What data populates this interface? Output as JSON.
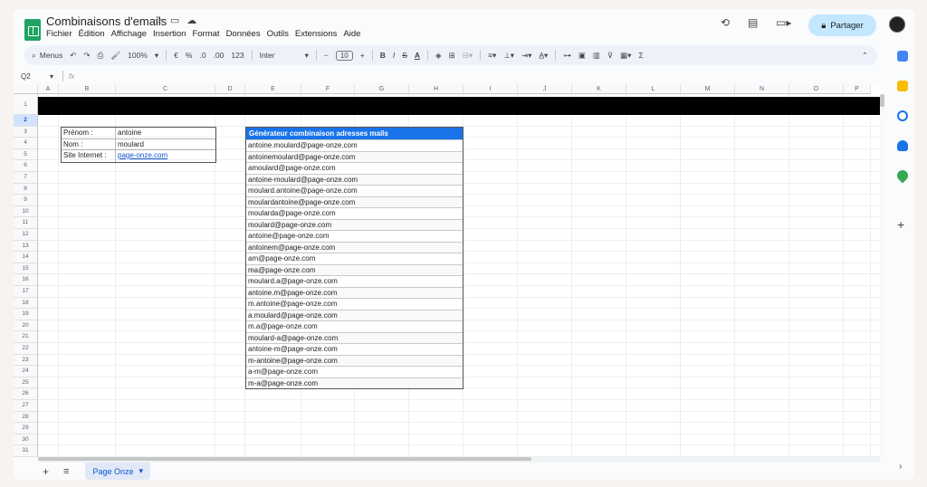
{
  "doc": {
    "title": "Combinaisons d'emails",
    "menu": [
      "Fichier",
      "Édition",
      "Affichage",
      "Insertion",
      "Format",
      "Données",
      "Outils",
      "Extensions",
      "Aide"
    ]
  },
  "share": {
    "label": "Partager"
  },
  "toolbar": {
    "search_label": "Menus",
    "zoom": "100%",
    "currency": "€",
    "percent": "%",
    "dec_less": ".0",
    "dec_more": ".00",
    "number_format": "123",
    "font": "Inter",
    "font_size": "10",
    "minus": "−",
    "plus": "+",
    "bold": "B",
    "italic": "I",
    "strike": "S",
    "sigma": "Σ"
  },
  "formula_bar": {
    "cell_ref": "Q2",
    "fx": "fx"
  },
  "columns": [
    "A",
    "B",
    "C",
    "D",
    "E",
    "F",
    "G",
    "H",
    "I",
    "J",
    "K",
    "L",
    "M",
    "N",
    "O",
    "P"
  ],
  "rows": [
    "1",
    "2",
    "3",
    "4",
    "5",
    "6",
    "7",
    "8",
    "9",
    "10",
    "11",
    "12",
    "13",
    "14",
    "15",
    "16",
    "17",
    "18",
    "19",
    "20",
    "21",
    "22",
    "23",
    "24",
    "25",
    "26",
    "27",
    "28",
    "29",
    "30",
    "31"
  ],
  "info_table": {
    "rows": [
      {
        "label": "Prénom :",
        "value": "antoine"
      },
      {
        "label": "Nom :",
        "value": "moulard"
      },
      {
        "label": "Site Internet :",
        "value": "page-onze.com"
      }
    ]
  },
  "generator": {
    "header": "Générateur combinaison adresses mails",
    "emails": [
      "antoine.moulard@page-onze.com",
      "antoinemoulard@page-onze.com",
      "amoulard@page-onze.com",
      "antoine-moulard@page-onze.com",
      "moulard.antoine@page-onze.com",
      "moulardantoine@page-onze.com",
      "moularda@page-onze.com",
      "moulard@page-onze.com",
      "antoine@page-onze.com",
      "antoinem@page-onze.com",
      "am@page-onze.com",
      "ma@page-onze.com",
      "moulard.a@page-onze.com",
      "antoine.m@page-onze.com",
      "m.antoine@page-onze.com",
      "a.moulard@page-onze.com",
      "m.a@page-onze.com",
      "moulard-a@page-onze.com",
      "antoine-m@page-onze.com",
      "m-antoine@page-onze.com",
      "a-m@page-onze.com",
      "m-a@page-onze.com"
    ]
  },
  "sheets": [
    {
      "label": "Page Onze"
    }
  ],
  "colors": {
    "accent": "#1a73e8",
    "share_bg": "#c2e7ff",
    "brand_green": "#1fa463"
  }
}
